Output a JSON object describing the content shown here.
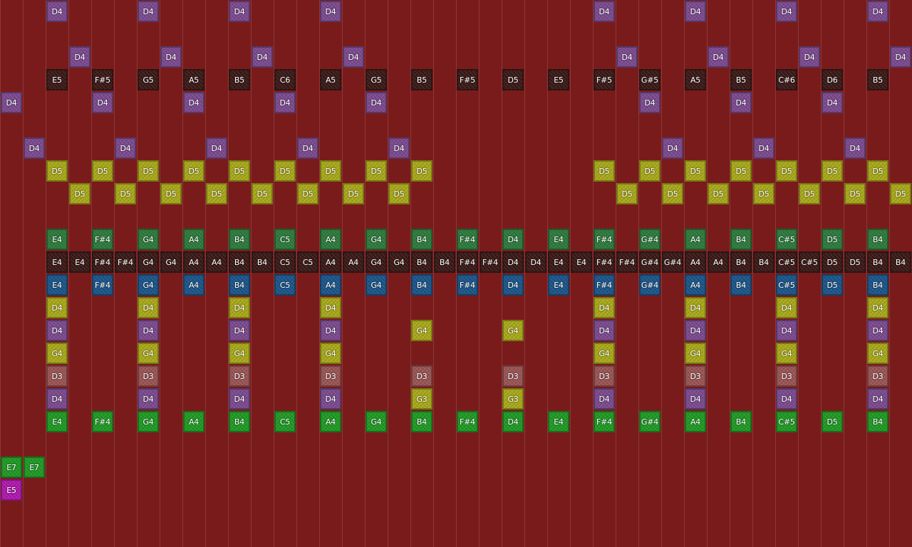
{
  "colors": {
    "background": "#7a1b1b",
    "gridline": "#9a4040",
    "lanes": {
      "purple": "#7b4a8f",
      "brown": "#3a1a17",
      "olive": "#a8a81a",
      "darkgreen": "#2d7a3c",
      "blue": "#1b5589",
      "rose": "#9a5454",
      "green": "#1f9a24",
      "magenta": "#b018ad"
    }
  },
  "rows": [
    {
      "color": "purple",
      "notes": [
        [
          2,
          "D4"
        ],
        [
          6,
          "D4"
        ],
        [
          10,
          "D4"
        ],
        [
          14,
          "D4"
        ],
        [
          26,
          "D4"
        ],
        [
          30,
          "D4"
        ],
        [
          34,
          "D4"
        ],
        [
          38,
          "D4"
        ]
      ]
    },
    {
      "color": "purple",
      "notes": []
    },
    {
      "color": "purple",
      "notes": [
        [
          3,
          "D4"
        ],
        [
          7,
          "D4"
        ],
        [
          11,
          "D4"
        ],
        [
          15,
          "D4"
        ],
        [
          27,
          "D4"
        ],
        [
          31,
          "D4"
        ],
        [
          35,
          "D4"
        ],
        [
          39,
          "D4"
        ]
      ]
    },
    {
      "color": "brown",
      "notes": [
        [
          2,
          "E5"
        ],
        [
          4,
          "F#5"
        ],
        [
          6,
          "G5"
        ],
        [
          8,
          "A5"
        ],
        [
          10,
          "B5"
        ],
        [
          12,
          "C6"
        ],
        [
          14,
          "A5"
        ],
        [
          16,
          "G5"
        ],
        [
          18,
          "B5"
        ],
        [
          20,
          "F#5"
        ],
        [
          22,
          "D5"
        ],
        [
          24,
          "E5"
        ],
        [
          26,
          "F#5"
        ],
        [
          28,
          "G#5"
        ],
        [
          30,
          "A5"
        ],
        [
          32,
          "B5"
        ],
        [
          34,
          "C#6"
        ],
        [
          36,
          "D6"
        ],
        [
          38,
          "B5"
        ]
      ]
    },
    {
      "color": "purple",
      "notes": [
        [
          0,
          "D4"
        ],
        [
          4,
          "D4"
        ],
        [
          8,
          "D4"
        ],
        [
          12,
          "D4"
        ],
        [
          16,
          "D4"
        ],
        [
          28,
          "D4"
        ],
        [
          32,
          "D4"
        ],
        [
          36,
          "D4"
        ]
      ]
    },
    {
      "color": "purple",
      "notes": []
    },
    {
      "color": "purple",
      "notes": [
        [
          1,
          "D4"
        ],
        [
          5,
          "D4"
        ],
        [
          9,
          "D4"
        ],
        [
          13,
          "D4"
        ],
        [
          17,
          "D4"
        ],
        [
          29,
          "D4"
        ],
        [
          33,
          "D4"
        ],
        [
          37,
          "D4"
        ]
      ]
    },
    {
      "color": "olive",
      "notes": [
        [
          2,
          "D5"
        ],
        [
          4,
          "D5"
        ],
        [
          6,
          "D5"
        ],
        [
          8,
          "D5"
        ],
        [
          10,
          "D5"
        ],
        [
          12,
          "D5"
        ],
        [
          14,
          "D5"
        ],
        [
          16,
          "D5"
        ],
        [
          18,
          "D5"
        ],
        [
          26,
          "D5"
        ],
        [
          28,
          "D5"
        ],
        [
          30,
          "D5"
        ],
        [
          32,
          "D5"
        ],
        [
          34,
          "D5"
        ],
        [
          36,
          "D5"
        ],
        [
          38,
          "D5"
        ]
      ]
    },
    {
      "color": "olive",
      "notes": [
        [
          3,
          "D5"
        ],
        [
          5,
          "D5"
        ],
        [
          7,
          "D5"
        ],
        [
          9,
          "D5"
        ],
        [
          11,
          "D5"
        ],
        [
          13,
          "D5"
        ],
        [
          15,
          "D5"
        ],
        [
          17,
          "D5"
        ],
        [
          27,
          "D5"
        ],
        [
          29,
          "D5"
        ],
        [
          31,
          "D5"
        ],
        [
          33,
          "D5"
        ],
        [
          35,
          "D5"
        ],
        [
          37,
          "D5"
        ],
        [
          39,
          "D5"
        ]
      ]
    },
    {
      "color": "olive",
      "notes": []
    },
    {
      "color": "darkgreen",
      "notes": [
        [
          2,
          "E4"
        ],
        [
          4,
          "F#4"
        ],
        [
          6,
          "G4"
        ],
        [
          8,
          "A4"
        ],
        [
          10,
          "B4"
        ],
        [
          12,
          "C5"
        ],
        [
          14,
          "A4"
        ],
        [
          16,
          "G4"
        ],
        [
          18,
          "B4"
        ],
        [
          20,
          "F#4"
        ],
        [
          22,
          "D4"
        ],
        [
          24,
          "E4"
        ],
        [
          26,
          "F#4"
        ],
        [
          28,
          "G#4"
        ],
        [
          30,
          "A4"
        ],
        [
          32,
          "B4"
        ],
        [
          34,
          "C#5"
        ],
        [
          36,
          "D5"
        ],
        [
          38,
          "B4"
        ]
      ]
    },
    {
      "color": "brown",
      "notes": [
        [
          2,
          "E4"
        ],
        [
          3,
          "E4"
        ],
        [
          4,
          "F#4"
        ],
        [
          5,
          "F#4"
        ],
        [
          6,
          "G4"
        ],
        [
          7,
          "G4"
        ],
        [
          8,
          "A4"
        ],
        [
          9,
          "A4"
        ],
        [
          10,
          "B4"
        ],
        [
          11,
          "B4"
        ],
        [
          12,
          "C5"
        ],
        [
          13,
          "C5"
        ],
        [
          14,
          "A4"
        ],
        [
          15,
          "A4"
        ],
        [
          16,
          "G4"
        ],
        [
          17,
          "G4"
        ],
        [
          18,
          "B4"
        ],
        [
          19,
          "B4"
        ],
        [
          20,
          "F#4"
        ],
        [
          21,
          "F#4"
        ],
        [
          22,
          "D4"
        ],
        [
          23,
          "D4"
        ],
        [
          24,
          "E4"
        ],
        [
          25,
          "E4"
        ],
        [
          26,
          "F#4"
        ],
        [
          27,
          "F#4"
        ],
        [
          28,
          "G#4"
        ],
        [
          29,
          "G#4"
        ],
        [
          30,
          "A4"
        ],
        [
          31,
          "A4"
        ],
        [
          32,
          "B4"
        ],
        [
          33,
          "B4"
        ],
        [
          34,
          "C#5"
        ],
        [
          35,
          "C#5"
        ],
        [
          36,
          "D5"
        ],
        [
          37,
          "D5"
        ],
        [
          38,
          "B4"
        ],
        [
          39,
          "B4"
        ]
      ]
    },
    {
      "color": "blue",
      "notes": [
        [
          2,
          "E4"
        ],
        [
          4,
          "F#4"
        ],
        [
          6,
          "G4"
        ],
        [
          8,
          "A4"
        ],
        [
          10,
          "B4"
        ],
        [
          12,
          "C5"
        ],
        [
          14,
          "A4"
        ],
        [
          16,
          "G4"
        ],
        [
          18,
          "B4"
        ],
        [
          20,
          "F#4"
        ],
        [
          22,
          "D4"
        ],
        [
          24,
          "E4"
        ],
        [
          26,
          "F#4"
        ],
        [
          28,
          "G#4"
        ],
        [
          30,
          "A4"
        ],
        [
          32,
          "B4"
        ],
        [
          34,
          "C#5"
        ],
        [
          36,
          "D5"
        ],
        [
          38,
          "B4"
        ]
      ]
    },
    {
      "color": "olive",
      "notes": [
        [
          2,
          "D4"
        ],
        [
          6,
          "D4"
        ],
        [
          10,
          "D4"
        ],
        [
          14,
          "D4"
        ],
        [
          26,
          "D4"
        ],
        [
          30,
          "D4"
        ],
        [
          34,
          "D4"
        ],
        [
          38,
          "D4"
        ]
      ]
    },
    {
      "color": "purple",
      "notes": [
        [
          2,
          "D4"
        ],
        [
          6,
          "D4"
        ],
        [
          10,
          "D4"
        ],
        [
          14,
          "D4"
        ],
        [
          26,
          "D4"
        ],
        [
          30,
          "D4"
        ],
        [
          34,
          "D4"
        ],
        [
          38,
          "D4"
        ]
      ]
    },
    {
      "color": "olive",
      "notes": [
        [
          2,
          "G4"
        ],
        [
          6,
          "G4"
        ],
        [
          10,
          "G4"
        ],
        [
          14,
          "G4"
        ],
        [
          26,
          "G4"
        ],
        [
          30,
          "G4"
        ],
        [
          34,
          "G4"
        ],
        [
          38,
          "G4"
        ]
      ]
    },
    {
      "color": "rose",
      "notes": [
        [
          2,
          "D3"
        ],
        [
          6,
          "D3"
        ],
        [
          10,
          "D3"
        ],
        [
          14,
          "D3"
        ],
        [
          18,
          "D3"
        ],
        [
          22,
          "D3"
        ],
        [
          26,
          "D3"
        ],
        [
          30,
          "D3"
        ],
        [
          34,
          "D3"
        ],
        [
          38,
          "D3"
        ]
      ]
    },
    {
      "color": "purple",
      "notes": [
        [
          2,
          "D4"
        ],
        [
          6,
          "D4"
        ],
        [
          10,
          "D4"
        ],
        [
          14,
          "D4"
        ],
        [
          18,
          "D4"
        ],
        [
          22,
          "D4"
        ],
        [
          26,
          "D4"
        ],
        [
          30,
          "D4"
        ],
        [
          34,
          "D4"
        ],
        [
          38,
          "D4"
        ]
      ]
    },
    {
      "color": "green",
      "notes": [
        [
          2,
          "E4"
        ],
        [
          4,
          "F#4"
        ],
        [
          6,
          "G4"
        ],
        [
          8,
          "A4"
        ],
        [
          10,
          "B4"
        ],
        [
          12,
          "C5"
        ],
        [
          14,
          "A4"
        ],
        [
          16,
          "G4"
        ],
        [
          18,
          "B4"
        ],
        [
          20,
          "F#4"
        ],
        [
          22,
          "D4"
        ],
        [
          24,
          "E4"
        ],
        [
          26,
          "F#4"
        ],
        [
          28,
          "G#4"
        ],
        [
          30,
          "A4"
        ],
        [
          32,
          "B4"
        ],
        [
          34,
          "C#5"
        ],
        [
          36,
          "D5"
        ],
        [
          38,
          "B4"
        ]
      ]
    },
    {
      "color": "green",
      "notes": []
    },
    {
      "color": "green",
      "notes": [
        [
          0,
          "E7"
        ],
        [
          1,
          "E7"
        ]
      ]
    },
    {
      "color": "magenta",
      "notes": [
        [
          0,
          "E5"
        ]
      ]
    }
  ],
  "extra_notes": [
    {
      "row": 14,
      "col": 18,
      "label": "G4",
      "color": "olive"
    },
    {
      "row": 14,
      "col": 22,
      "label": "G4",
      "color": "olive"
    },
    {
      "row": 17,
      "col": 18,
      "label": "G3",
      "color": "olive"
    },
    {
      "row": 17,
      "col": 22,
      "label": "G3",
      "color": "olive"
    }
  ]
}
